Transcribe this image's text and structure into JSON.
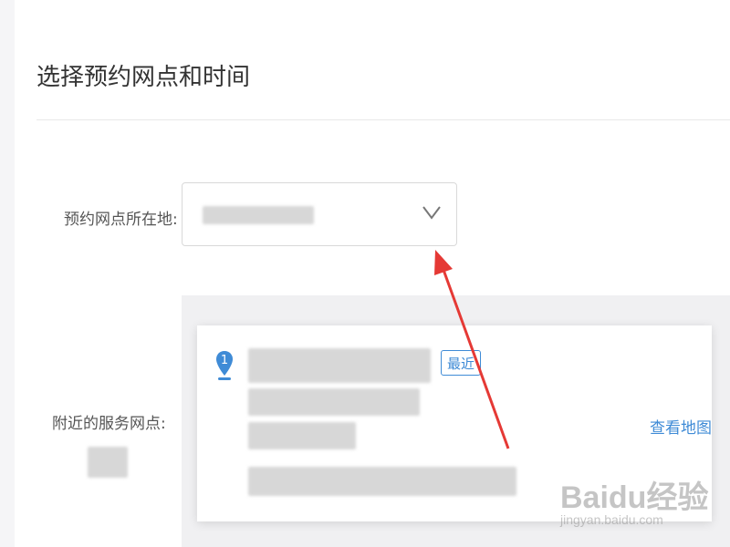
{
  "section": {
    "title": "选择预约网点和时间"
  },
  "location": {
    "label": "预约网点所在地:",
    "selected_value_blurred": true,
    "dropdown_icon": "chevron-down-icon"
  },
  "nearby": {
    "label": "附近的服务网点:",
    "items": [
      {
        "index": "1",
        "badge": "最近",
        "link": "查看地图",
        "content_blurred": true
      }
    ]
  },
  "watermark": {
    "brand": "Baidu经验",
    "url": "jingyan.baidu.com"
  },
  "colors": {
    "accent": "#3f8bd6",
    "annotation_arrow": "#e53935",
    "panel_bg": "#f0f0f2"
  }
}
